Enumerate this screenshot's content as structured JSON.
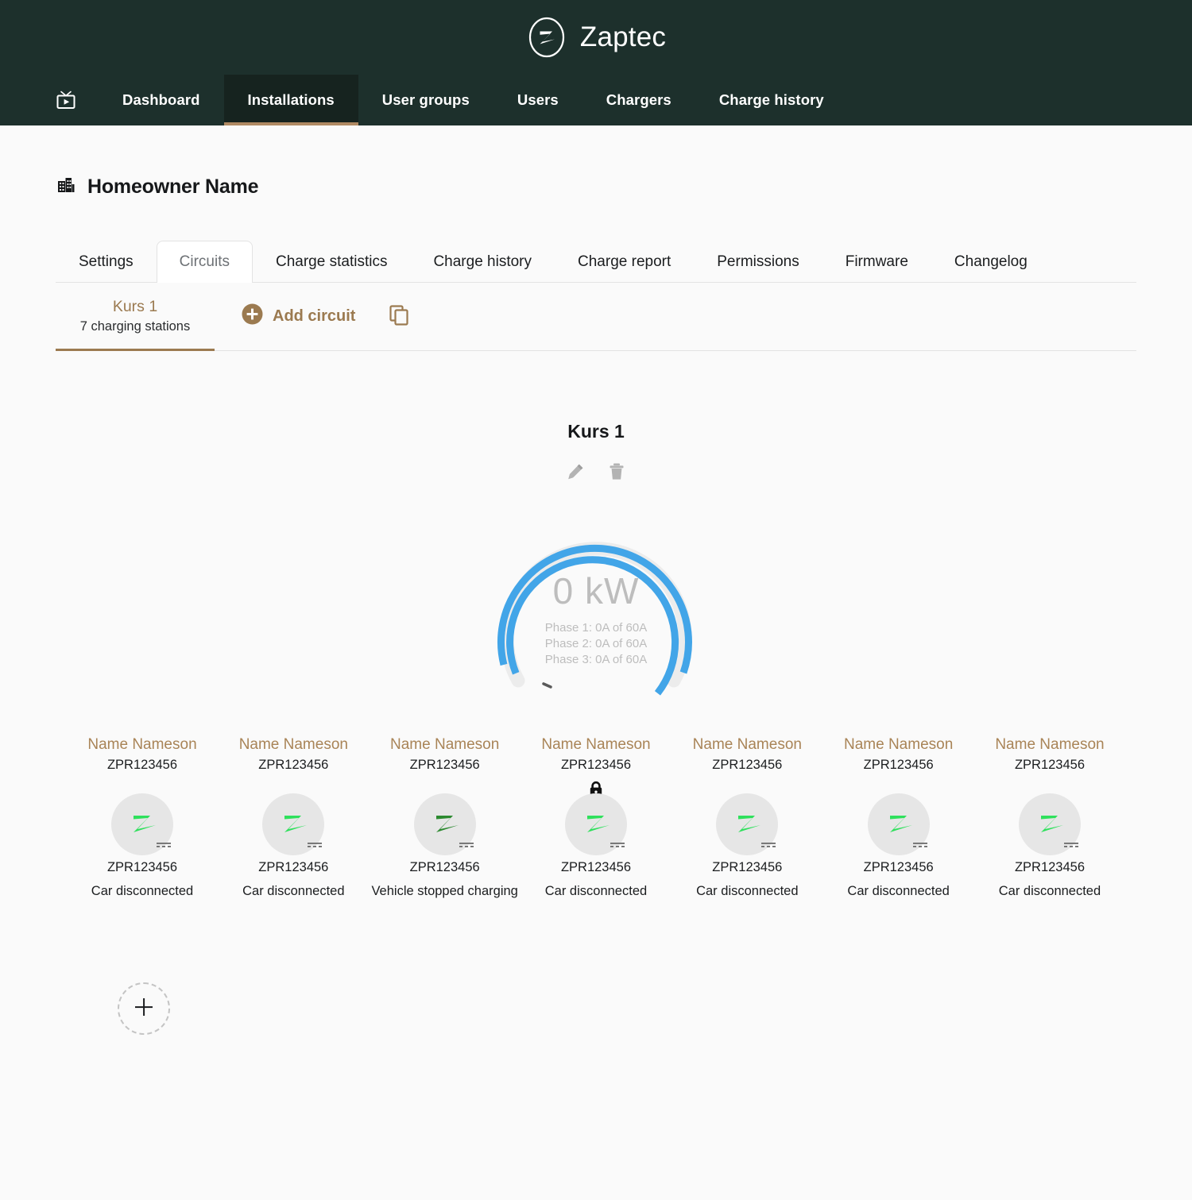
{
  "brand": {
    "name": "Zaptec",
    "logo_icon": "zaptec-circle-z-logo"
  },
  "nav": {
    "home_icon": "tv-dashboard-icon",
    "items": [
      {
        "label": "Dashboard",
        "active": false
      },
      {
        "label": "Installations",
        "active": true
      },
      {
        "label": "User groups",
        "active": false
      },
      {
        "label": "Users",
        "active": false
      },
      {
        "label": "Chargers",
        "active": false
      },
      {
        "label": "Charge history",
        "active": false
      }
    ]
  },
  "page": {
    "icon": "building-icon",
    "title": "Homeowner Name"
  },
  "tabs": [
    {
      "label": "Settings",
      "active": false
    },
    {
      "label": "Circuits",
      "active": true
    },
    {
      "label": "Charge statistics",
      "active": false
    },
    {
      "label": "Charge history",
      "active": false
    },
    {
      "label": "Charge report",
      "active": false
    },
    {
      "label": "Permissions",
      "active": false
    },
    {
      "label": "Firmware",
      "active": false
    },
    {
      "label": "Changelog",
      "active": false
    }
  ],
  "subtabs": {
    "circuits": [
      {
        "name": "Kurs 1",
        "subtitle": "7 charging stations",
        "active": true
      }
    ],
    "add_circuit_label": "Add circuit",
    "add_circuit_icon": "plus-circle-icon",
    "copy_icon": "copy-icon"
  },
  "circuit": {
    "name": "Kurs 1",
    "edit_icon": "pencil-icon",
    "delete_icon": "trash-icon",
    "gauge": {
      "value": "0 kW",
      "phases": [
        "Phase 1: 0A of 60A",
        "Phase 2: 0A of 60A",
        "Phase 3: 0A of 60A"
      ],
      "track_color": "#ececec",
      "arc_color": "#42a5e8"
    }
  },
  "chargers": [
    {
      "user": "Name Nameson",
      "id": "ZPR123456",
      "device_id": "ZPR123456",
      "status": "Car disconnected",
      "icon": "zaptec-z-bolt-icon",
      "z_color": "#2fe05c",
      "locked": false
    },
    {
      "user": "Name Nameson",
      "id": "ZPR123456",
      "device_id": "ZPR123456",
      "status": "Car disconnected",
      "icon": "zaptec-z-bolt-icon",
      "z_color": "#2fe05c",
      "locked": false
    },
    {
      "user": "Name Nameson",
      "id": "ZPR123456",
      "device_id": "ZPR123456",
      "status": "Vehicle stopped charging",
      "icon": "zaptec-z-bolt-icon",
      "z_color": "#2c8a30",
      "locked": false
    },
    {
      "user": "Name Nameson",
      "id": "ZPR123456",
      "device_id": "ZPR123456",
      "status": "Car disconnected",
      "icon": "zaptec-z-bolt-icon",
      "z_color": "#2fe05c",
      "locked": true
    },
    {
      "user": "Name Nameson",
      "id": "ZPR123456",
      "device_id": "ZPR123456",
      "status": "Car disconnected",
      "icon": "zaptec-z-bolt-icon",
      "z_color": "#2fe05c",
      "locked": false
    },
    {
      "user": "Name Nameson",
      "id": "ZPR123456",
      "device_id": "ZPR123456",
      "status": "Car disconnected",
      "icon": "zaptec-z-bolt-icon",
      "z_color": "#2fe05c",
      "locked": false
    },
    {
      "user": "Name Nameson",
      "id": "ZPR123456",
      "device_id": "ZPR123456",
      "status": "Car disconnected",
      "icon": "zaptec-z-bolt-icon",
      "z_color": "#2fe05c",
      "locked": false
    }
  ],
  "add_charger": {
    "icon": "plus-icon"
  },
  "colors": {
    "header_bg": "#1d302c",
    "accent_brown": "#9b7a50",
    "user_brown": "#a98457",
    "gauge_blue": "#42a5e8",
    "green_active": "#2fe05c",
    "green_stopped": "#2c8a30"
  }
}
